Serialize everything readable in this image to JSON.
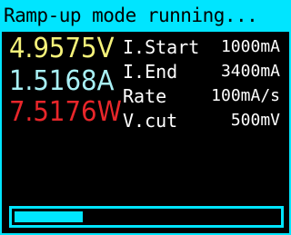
{
  "title": "Ramp-up mode running...",
  "readings": {
    "voltage": "4.9575V",
    "current": "1.5168A",
    "power": "7.5176W"
  },
  "params": [
    {
      "label": "I.Start",
      "value": "1000mA"
    },
    {
      "label": "I.End",
      "value": "3400mA"
    },
    {
      "label": "Rate",
      "value": "100mA/s"
    },
    {
      "label": "V.cut",
      "value": "500mV"
    }
  ],
  "progress": 0.26,
  "colors": {
    "accent": "#00e5ff",
    "voltage": "#f5f27a",
    "current": "#a8f0f5",
    "power": "#e8262a",
    "text": "#ffffff",
    "background": "#000000"
  }
}
